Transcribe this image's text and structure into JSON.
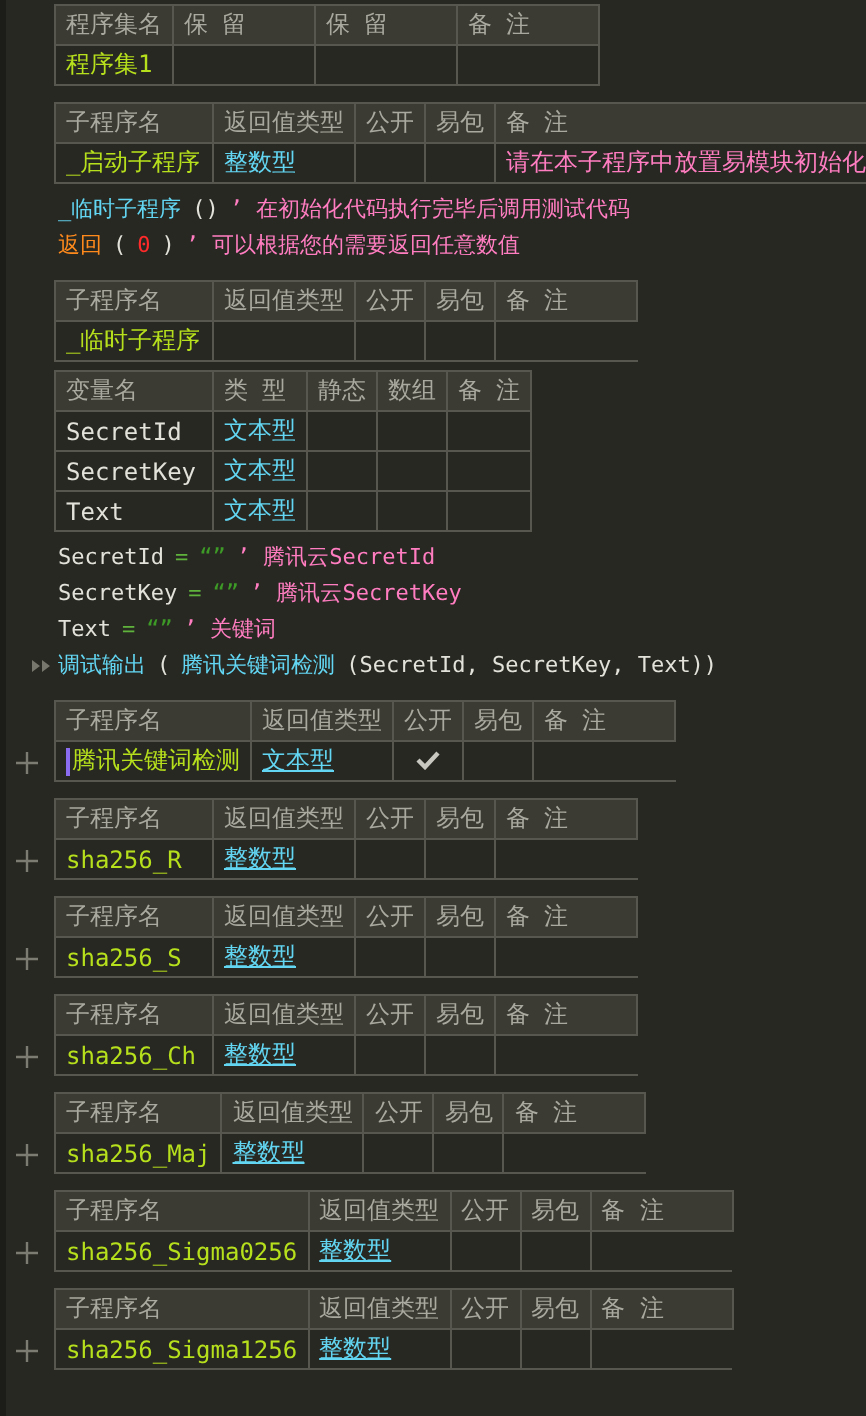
{
  "sections": [
    {
      "kind": "assembly",
      "columns": [
        "程序集名",
        "保 留",
        "保 留",
        "备 注"
      ],
      "name": "程序集1"
    },
    {
      "kind": "sub",
      "columns": [
        "子程序名",
        "返回值类型",
        "公开",
        "易包",
        "备 注"
      ],
      "name": "_启动子程序",
      "return_type": "整数型",
      "linked": false,
      "public": false,
      "comment": "请在本子程序中放置易模块初始化"
    },
    {
      "kind": "code",
      "lines": [
        {
          "debug": false,
          "tokens": [
            {
              "kind": "call",
              "text": "_临时子程序"
            },
            {
              "kind": "plain",
              "text": "()"
            },
            {
              "kind": "comment",
              "text": "’ 在初始化代码执行完毕后调用测试代码"
            }
          ]
        },
        {
          "debug": false,
          "tokens": [
            {
              "kind": "keyword",
              "text": "返回"
            },
            {
              "kind": "plain",
              "text": "("
            },
            {
              "kind": "number",
              "text": "0"
            },
            {
              "kind": "plain",
              "text": ")"
            },
            {
              "kind": "comment",
              "text": "’ 可以根据您的需要返回任意数值"
            }
          ]
        }
      ]
    },
    {
      "kind": "sub",
      "columns": [
        "子程序名",
        "返回值类型",
        "公开",
        "易包",
        "备 注"
      ],
      "name": "_临时子程序",
      "public": false
    },
    {
      "kind": "vars",
      "columns": [
        "变量名",
        "类 型",
        "静态",
        "数组",
        "备 注"
      ],
      "rows": [
        {
          "name": "SecretId",
          "type": "文本型"
        },
        {
          "name": "SecretKey",
          "type": "文本型"
        },
        {
          "name": "Text",
          "type": "文本型"
        }
      ]
    },
    {
      "kind": "code",
      "lines": [
        {
          "debug": false,
          "tokens": [
            {
              "kind": "plain",
              "text": "SecretId"
            },
            {
              "kind": "op",
              "text": "="
            },
            {
              "kind": "string",
              "text": "“”"
            },
            {
              "kind": "comment",
              "text": "’ 腾讯云SecretId"
            }
          ]
        },
        {
          "debug": false,
          "tokens": [
            {
              "kind": "plain",
              "text": "SecretKey"
            },
            {
              "kind": "op",
              "text": "="
            },
            {
              "kind": "string",
              "text": "“”"
            },
            {
              "kind": "comment",
              "text": "’ 腾讯云SecretKey"
            }
          ]
        },
        {
          "debug": false,
          "tokens": [
            {
              "kind": "plain",
              "text": "Text"
            },
            {
              "kind": "op",
              "text": "="
            },
            {
              "kind": "string",
              "text": "“”"
            },
            {
              "kind": "comment",
              "text": "’ 关键词"
            }
          ]
        },
        {
          "debug": true,
          "tokens": [
            {
              "kind": "call",
              "text": "调试输出"
            },
            {
              "kind": "plain",
              "text": "("
            },
            {
              "kind": "call",
              "text": "腾讯关键词检测"
            },
            {
              "kind": "plain",
              "text": "(SecretId, SecretKey, Text))"
            }
          ]
        }
      ]
    },
    {
      "kind": "sub",
      "columns": [
        "子程序名",
        "返回值类型",
        "公开",
        "易包",
        "备 注"
      ],
      "name": "腾讯关键词检测",
      "return_type": "文本型",
      "linked": true,
      "public": true,
      "expanded": false,
      "caret": true
    },
    {
      "kind": "sub",
      "columns": [
        "子程序名",
        "返回值类型",
        "公开",
        "易包",
        "备 注"
      ],
      "name": "sha256_R",
      "return_type": "整数型",
      "linked": true,
      "public": false,
      "expanded": false
    },
    {
      "kind": "sub",
      "columns": [
        "子程序名",
        "返回值类型",
        "公开",
        "易包",
        "备 注"
      ],
      "name": "sha256_S",
      "return_type": "整数型",
      "linked": true,
      "public": false,
      "expanded": false
    },
    {
      "kind": "sub",
      "columns": [
        "子程序名",
        "返回值类型",
        "公开",
        "易包",
        "备 注"
      ],
      "name": "sha256_Ch",
      "return_type": "整数型",
      "linked": true,
      "public": false,
      "expanded": false
    },
    {
      "kind": "sub",
      "columns": [
        "子程序名",
        "返回值类型",
        "公开",
        "易包",
        "备 注"
      ],
      "name": "sha256_Maj",
      "return_type": "整数型",
      "linked": true,
      "public": false,
      "expanded": false
    },
    {
      "kind": "sub",
      "columns": [
        "子程序名",
        "返回值类型",
        "公开",
        "易包",
        "备 注"
      ],
      "name": "sha256_Sigma0256",
      "return_type": "整数型",
      "linked": true,
      "public": false,
      "expanded": false
    },
    {
      "kind": "sub",
      "columns": [
        "子程序名",
        "返回值类型",
        "公开",
        "易包",
        "备 注"
      ],
      "name": "sha256_Sigma1256",
      "return_type": "整数型",
      "linked": true,
      "public": false,
      "expanded": false
    }
  ]
}
